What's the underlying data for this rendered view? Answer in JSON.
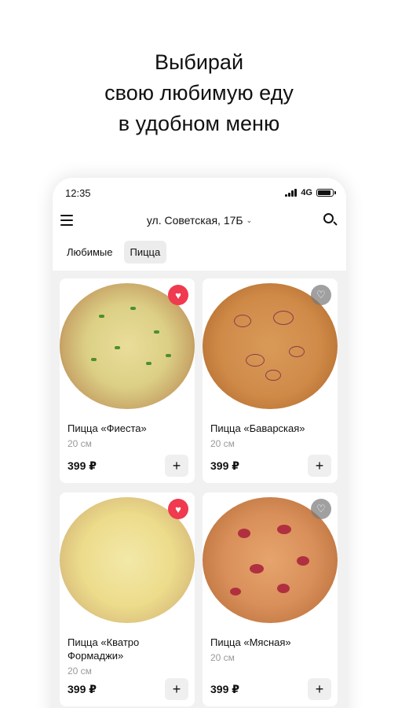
{
  "headline": {
    "line1": "Выбирай",
    "line2": "свою любимую еду",
    "line3": "в удобном меню"
  },
  "status_bar": {
    "time": "12:35",
    "network": "4G"
  },
  "header": {
    "address": "ул. Советская, 17Б",
    "menu_icon": "hamburger-menu-icon",
    "search_icon": "search-icon",
    "address_chevron_icon": "chevron-down-icon"
  },
  "tabs": [
    {
      "label": "Любимые",
      "active": false
    },
    {
      "label": "Пицца",
      "active": true
    }
  ],
  "products": [
    {
      "name": "Пицца «Фиеста»",
      "size": "20 см",
      "price": "399 ₽",
      "favorite": true
    },
    {
      "name": "Пицца «Баварская»",
      "size": "20 см",
      "price": "399 ₽",
      "favorite": false
    },
    {
      "name": "Пицца «Кватро Формаджи»",
      "size": "20 см",
      "price": "399 ₽",
      "favorite": true
    },
    {
      "name": "Пицца «Мясная»",
      "size": "20 см",
      "price": "399 ₽",
      "favorite": false
    }
  ],
  "add_label": "+",
  "colors": {
    "favorite_active": "#ef3a4f",
    "favorite_inactive": "#8a8a8a",
    "tab_active_bg": "#ececec",
    "phone_bg": "#f1f1f1"
  }
}
